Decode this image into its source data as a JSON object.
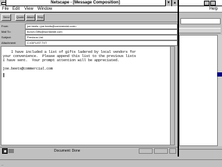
{
  "window": {
    "title": "Netscape - [Message Composition]"
  },
  "background_window": {
    "menu_help": "Help"
  },
  "menu": {
    "file": "File",
    "edit": "Edit",
    "view": "View",
    "window": "Window"
  },
  "toolbar": {
    "send": "Send",
    "quote": "Quote",
    "attach": "Attach",
    "stop": "Stop"
  },
  "header": {
    "from_label": "From:",
    "from_value": "joe.beets <joe.beets@commercial.com>",
    "mailto_label": "Mail To:",
    "mailto_value": "bunch.Gifts@worldwide.com",
    "subject_label": "Subject:",
    "subject_value": "Previous List",
    "attachment_label": "Attachment:",
    "attachment_value": "C:\\GIFLIST.TXT"
  },
  "body": {
    "text": "    I have included a list of gifts ladered by local vendors for\nyour convenience.  Please append this list to the previous lists\nI have sent.  Your prompt attention will be appreciated.\n\njoe.beets@commercial.com"
  },
  "status": {
    "text": "Document: Done"
  },
  "taskbar": {
    "label": "..."
  },
  "colors": {
    "chrome": "#c0c0c0",
    "selection": "#000080"
  }
}
